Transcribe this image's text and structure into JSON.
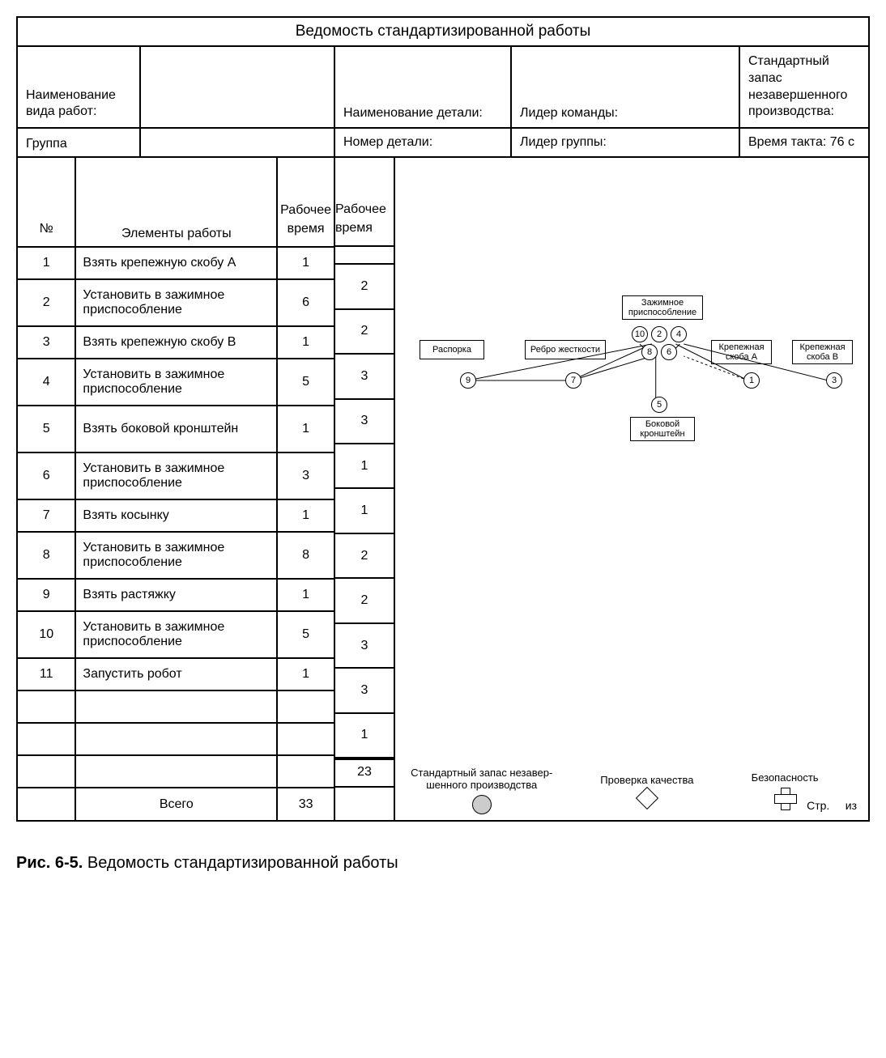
{
  "title": "Ведомость стандартизированной работы",
  "header": {
    "work_type_label": "Наименование вида работ:",
    "part_name_label": "Наименование детали:",
    "team_leader_label": "Лидер команды:",
    "std_wip_label": "Стандартный запас незавершенного про­изводства:",
    "group_label": "Группа",
    "part_no_label": "Номер детали:",
    "group_leader_label": "Лидер группы:",
    "takt_label": "Время такта: 76 с"
  },
  "columns": {
    "no": "№",
    "elements": "Элементы работы",
    "work_time": "Рабо­чее время",
    "work_time2": "Рабо­чее вре­мя"
  },
  "rows": [
    {
      "n": "1",
      "e": "Взять крепежную скобу А",
      "t": "1",
      "tall": false
    },
    {
      "n": "2",
      "e": "Установить в зажимное приспособление",
      "t": "6",
      "tall": true
    },
    {
      "n": "3",
      "e": "Взять крепежную скобу В",
      "t": "1",
      "tall": false
    },
    {
      "n": "4",
      "e": "Установить в зажимное приспособление",
      "t": "5",
      "tall": true
    },
    {
      "n": "5",
      "e": "Взять боковой крон­штейн",
      "t": "1",
      "tall": true
    },
    {
      "n": "6",
      "e": "Установить в зажимное приспособление",
      "t": "3",
      "tall": true
    },
    {
      "n": "7",
      "e": "Взять косынку",
      "t": "1",
      "tall": false
    },
    {
      "n": "8",
      "e": "Установить в зажимное приспособление",
      "t": "8",
      "tall": true
    },
    {
      "n": "9",
      "e": "Взять растяжку",
      "t": "1",
      "tall": false
    },
    {
      "n": "10",
      "e": "Установить в зажимное приспособление",
      "t": "5",
      "tall": true
    },
    {
      "n": "11",
      "e": "Запустить робот",
      "t": "1",
      "tall": false
    }
  ],
  "blank_rows": 3,
  "total_label": "Всего",
  "total_value": "33",
  "mid_values": [
    "2",
    "2",
    "3",
    "3",
    "1",
    "1",
    "2",
    "2",
    "3",
    "3",
    "1",
    "23"
  ],
  "diagram": {
    "boxes": {
      "spreader": "Распорка",
      "rib": "Ребро жесткости",
      "fixture": "Зажимное приспособление",
      "bracketA": "Крепежная скоба А",
      "bracketB": "Крепежная скоба В",
      "side": "Боковой кронштейн"
    }
  },
  "legend": {
    "wip": "Стандартный запас незавер­шенного производства",
    "quality": "Проверка качества",
    "safety": "Безопасность",
    "page": "Стр.",
    "of": "из"
  },
  "caption_bold": "Рис. 6-5.",
  "caption_text": "  Ведомость стандартизированной работы"
}
